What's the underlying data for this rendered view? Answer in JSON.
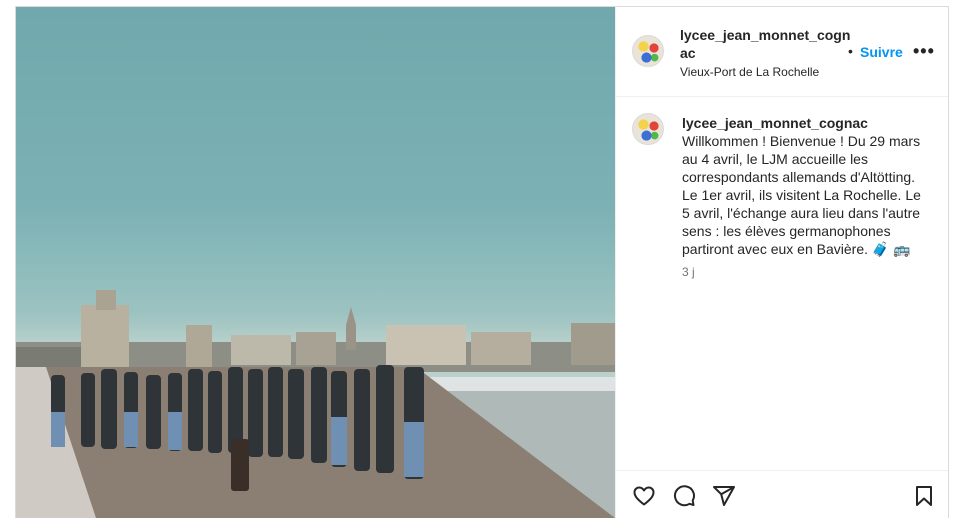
{
  "post": {
    "username": "lycee_jean_monnet_cognac",
    "location": "Vieux-Port de La Rochelle",
    "follow_label": "Suivre",
    "more_label": "•••",
    "dot": "•",
    "caption": "Willkommen ! Bienvenue ! Du 29 mars au 4 avril, le LJM accueille les correspondants allemands d'Altötting. Le 1er avril, ils visitent La Rochelle. Le 5 avril, l'échange aura lieu dans l'autre sens : les élèves germanophones partiront avec eux en Bavière. 🧳 🚌",
    "time": "3 j"
  },
  "actions": {
    "icons": [
      "heart-icon",
      "comment-icon",
      "share-icon",
      "save-icon"
    ]
  },
  "colors": {
    "accent": "#0095f6",
    "text": "#262626",
    "muted": "#737373",
    "border": "#dbdbdb"
  }
}
